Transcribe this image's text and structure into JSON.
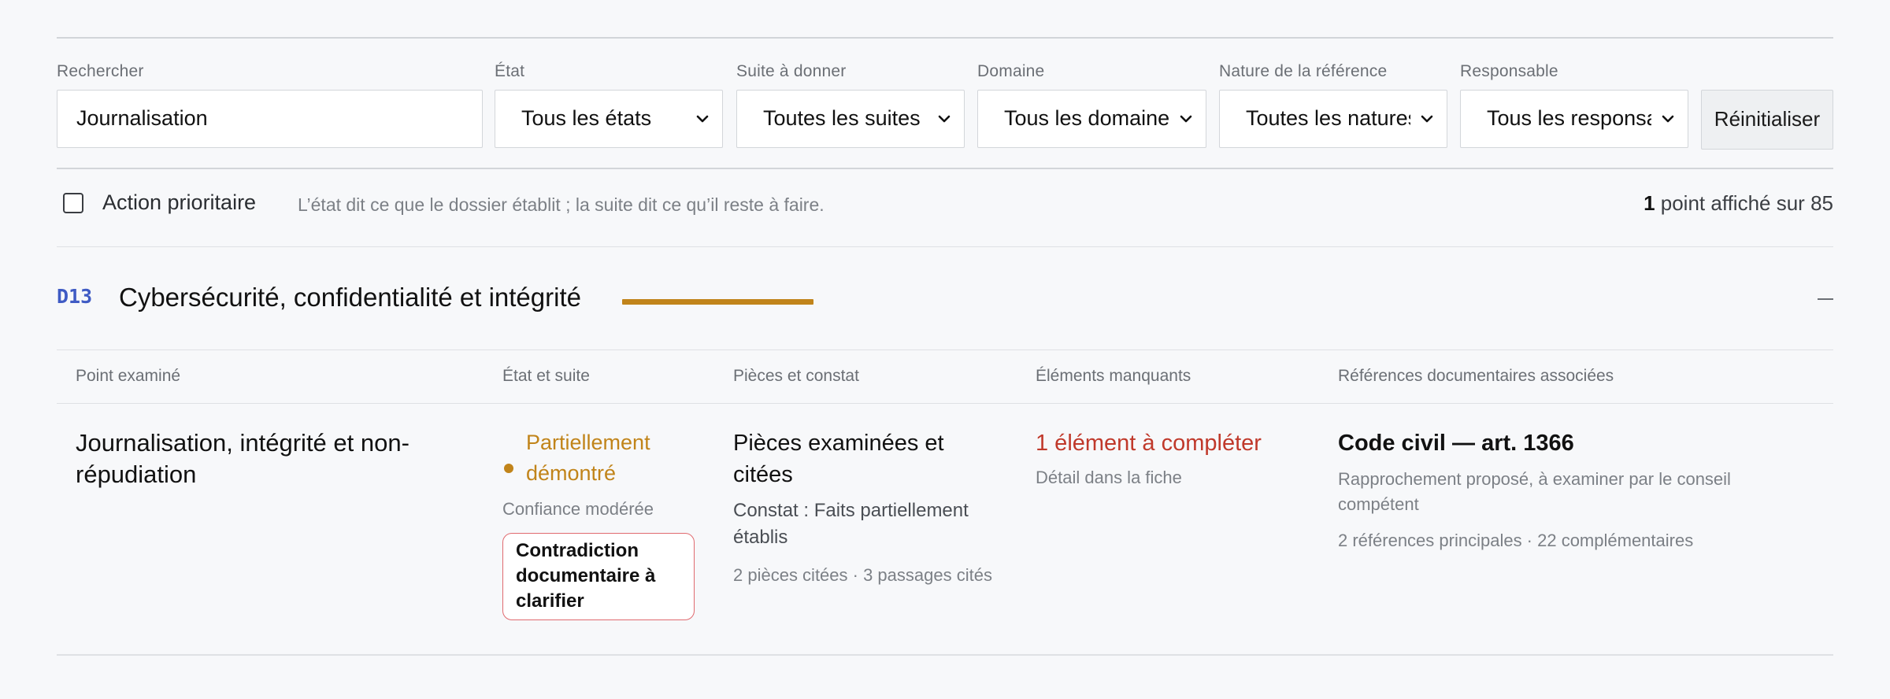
{
  "filters": {
    "search": {
      "label": "Rechercher",
      "value": "Journalisation"
    },
    "etat": {
      "label": "État",
      "value": "Tous les états"
    },
    "suite": {
      "label": "Suite à donner",
      "value": "Toutes les suites"
    },
    "domaine": {
      "label": "Domaine",
      "value": "Tous les domaines"
    },
    "nature": {
      "label": "Nature de la référence",
      "value": "Toutes les natures"
    },
    "responsable": {
      "label": "Responsable",
      "value": "Tous les responsables"
    },
    "reset_label": "Réinitialiser"
  },
  "options": {
    "priority_label": "Action prioritaire",
    "priority_checked": false,
    "hint": "L’état dit ce que le dossier établit ; la suite dit ce qu’il reste à faire.",
    "count_shown": "1",
    "count_rest": "point affiché sur 85"
  },
  "section": {
    "code": "D13",
    "title": "Cybersécurité, confidentialité et intégrité",
    "collapse_symbol": "–"
  },
  "table": {
    "headers": [
      "Point examiné",
      "État et suite",
      "Pièces et constat",
      "Éléments manquants",
      "Références documentaires associées"
    ],
    "rows": [
      {
        "point": "Journalisation, intégrité et non-répudiation",
        "state": "Partiellement démontré",
        "confidence": "Confiance modérée",
        "flag": "Contradiction documentaire à clarifier",
        "pieces_title": "Pièces examinées et citées",
        "pieces_constat": "Constat : Faits partiellement établis",
        "pieces_meta": "2 pièces citées · 3 passages cités",
        "missing_title": "1 élément à compléter",
        "missing_meta": "Détail dans la fiche",
        "ref_title": "Code civil — art. 1366",
        "ref_desc": "Rapprochement proposé, à examiner par le conseil compétent",
        "ref_meta": "2 références principales · 22 complémentaires"
      }
    ]
  },
  "colors": {
    "accent": "#c1841a",
    "code": "#3f5bc4",
    "missing": "#c0392b",
    "flag_border": "#e06a6f"
  }
}
